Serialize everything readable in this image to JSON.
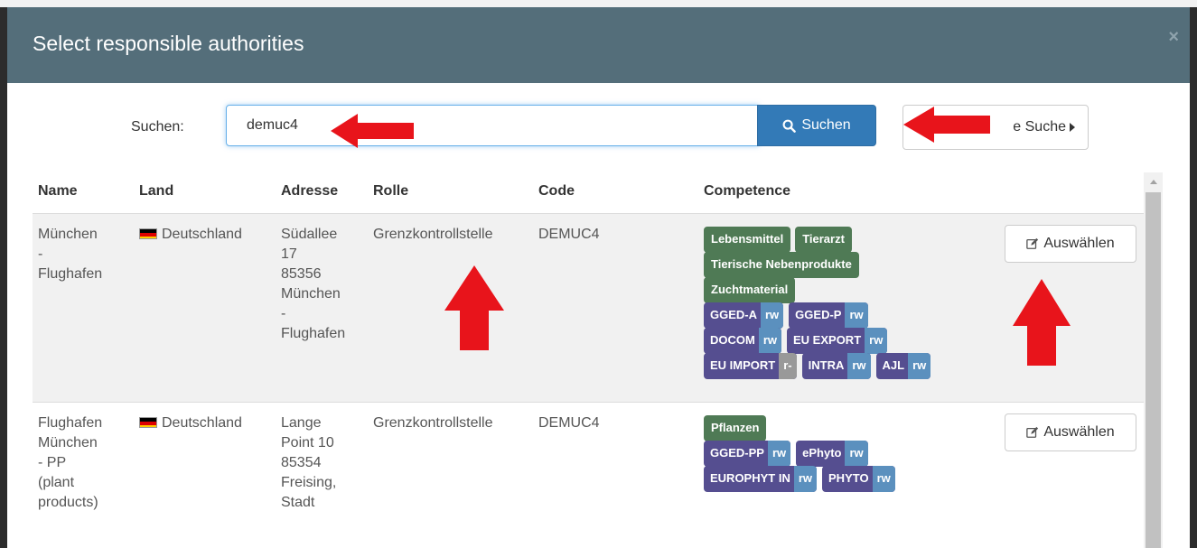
{
  "modal": {
    "title": "Select responsible authorities",
    "close_glyph": "×"
  },
  "search": {
    "label": "Suchen:",
    "value": "demuc4",
    "button_label": "Suchen",
    "advanced_label": "e Suche"
  },
  "table": {
    "headers": {
      "name": "Name",
      "land": "Land",
      "address": "Adresse",
      "role": "Rolle",
      "code": "Code",
      "competence": "Competence"
    },
    "rows": [
      {
        "name": [
          "München",
          "-",
          "Flughafen"
        ],
        "country": "Deutschland",
        "address": [
          "Südallee",
          "17",
          "85356",
          "München",
          "-",
          "Flughafen"
        ],
        "role": "Grenzkontrollstelle",
        "code": "DEMUC4",
        "competence_labels": [
          "Lebensmittel",
          "Tierarzt",
          "Tierische Nebenprodukte",
          "Zuchtmaterial"
        ],
        "apps": [
          {
            "name": "GGED-A",
            "rights": "rw"
          },
          {
            "name": "GGED-P",
            "rights": "rw"
          },
          {
            "name": "DOCOM",
            "rights": "rw"
          },
          {
            "name": "EU EXPORT",
            "rights": "rw"
          },
          {
            "name": "EU IMPORT",
            "rights": "r-"
          },
          {
            "name": "INTRA",
            "rights": "rw"
          },
          {
            "name": "AJL",
            "rights": "rw"
          }
        ],
        "select_label": "Auswählen"
      },
      {
        "name": [
          "Flughafen",
          "München",
          "- PP",
          "(plant",
          "products)"
        ],
        "country": "Deutschland",
        "address": [
          "Lange",
          "Point 10",
          "85354",
          "Freising,",
          "Stadt"
        ],
        "role": "Grenzkontrollstelle",
        "code": "DEMUC4",
        "competence_labels": [
          "Pflanzen"
        ],
        "apps": [
          {
            "name": "GGED-PP",
            "rights": "rw"
          },
          {
            "name": "ePhyto",
            "rights": "rw"
          },
          {
            "name": "EUROPHYT IN",
            "rights": "rw"
          },
          {
            "name": "PHYTO",
            "rights": "rw"
          }
        ],
        "select_label": "Auswählen"
      }
    ]
  },
  "colors": {
    "header_bg": "#546e7a",
    "primary_button": "#337ab7",
    "competence_badge": "#4f7a55",
    "app_badge": "#554e90",
    "rights_badge": "#5b90be",
    "annotation_arrow": "#e8141b"
  },
  "icons": {
    "close": "close-icon",
    "search": "search-icon",
    "edit": "edit-icon",
    "caret": "caret-right-icon",
    "flag": "germany-flag-icon"
  }
}
